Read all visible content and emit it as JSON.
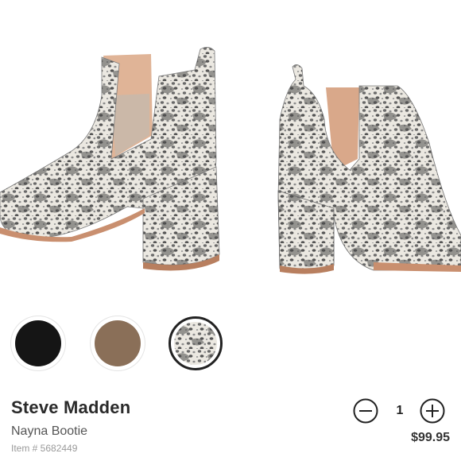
{
  "colors": {
    "swatch_black": "#151515",
    "swatch_taupe": "#8a6f58",
    "swatch_snake_base": "#e9e6df",
    "swatch_snake_scale": "#5d5d5d",
    "heel_sole": "#c98f6f",
    "lining": "#d9a88a"
  },
  "swatches": [
    {
      "name": "black",
      "selected": false
    },
    {
      "name": "taupe",
      "selected": false
    },
    {
      "name": "snake-print",
      "selected": true
    }
  ],
  "product": {
    "brand": "Steve Madden",
    "name": "Nayna Bootie",
    "item_number": "Item # 5682449",
    "price": "$99.95"
  },
  "quantity": {
    "value": "1",
    "decrement_icon": "minus-circle-icon",
    "increment_icon": "plus-circle-icon"
  }
}
